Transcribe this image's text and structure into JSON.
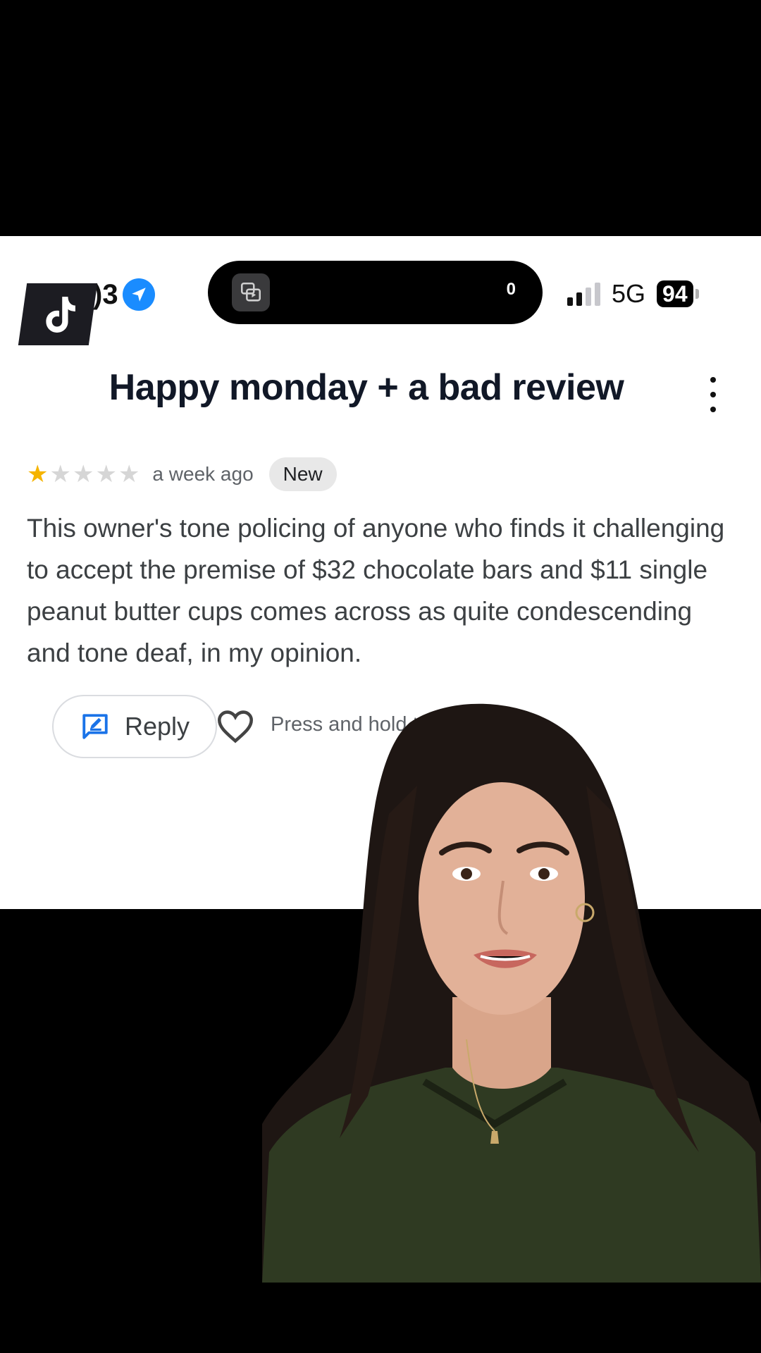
{
  "status_bar": {
    "time_partial": ")3",
    "island_count": "0",
    "network": "5G",
    "battery": "94"
  },
  "header": {
    "title": "Happy monday + a bad review"
  },
  "review": {
    "rating": 1,
    "max_rating": 5,
    "time_ago": "a week ago",
    "badge": "New",
    "text": "This owner's tone policing of anyone who finds it challenging to accept the premise of $32 chocolate bars and $11 single peanut butter cups comes across as quite condescending and tone deaf, in my opinion."
  },
  "actions": {
    "reply_label": "Reply",
    "hold_hint": "Press and hold to rea"
  },
  "colors": {
    "accent_blue": "#1a73e8",
    "star_gold": "#f5b400",
    "location_blue": "#1a8cff"
  },
  "icons": [
    "tiktok-logo",
    "location-arrow-icon",
    "screen-mirror-icon",
    "signal-icon",
    "more-vertical-icon",
    "star-icon",
    "reply-icon",
    "heart-icon"
  ]
}
